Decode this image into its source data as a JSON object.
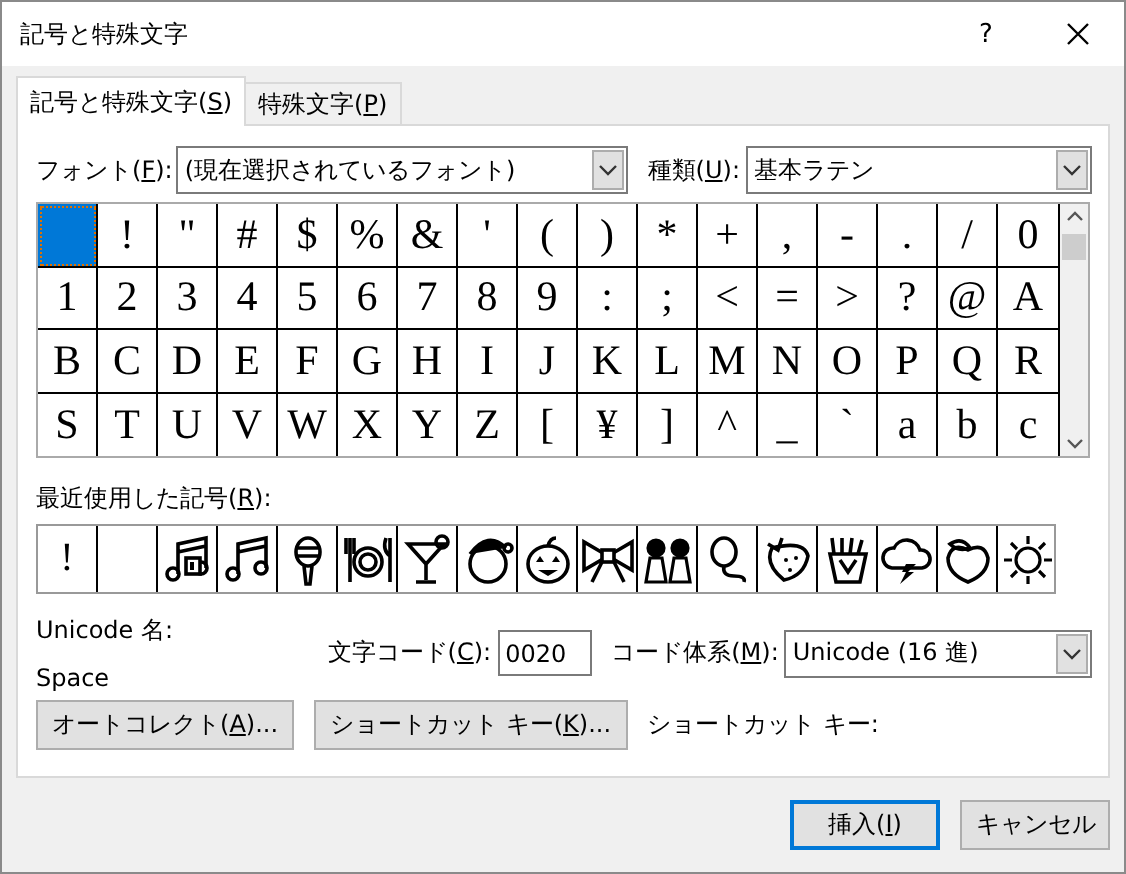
{
  "window": {
    "title": "記号と特殊文字",
    "help": "?"
  },
  "tabs": [
    {
      "before": "記号と特殊文字(",
      "key": "S",
      "after": ")",
      "selected": true
    },
    {
      "before": "特殊文字(",
      "key": "P",
      "after": ")",
      "selected": false
    }
  ],
  "font": {
    "label": {
      "before": "フォント(",
      "key": "F",
      "after": "):"
    },
    "value": "(現在選択されているフォント)"
  },
  "subset": {
    "label": {
      "before": "種類(",
      "key": "U",
      "after": "):"
    },
    "value": "基本ラテン"
  },
  "symbol_grid": [
    {
      "selected": true
    },
    {
      "char": "!",
      "selected": false
    },
    {
      "char": "\"",
      "selected": false
    },
    {
      "char": "#",
      "selected": false
    },
    {
      "char": "$",
      "selected": false
    },
    {
      "char": "%",
      "selected": false
    },
    {
      "char": "&",
      "selected": false
    },
    {
      "char": "'",
      "selected": false
    },
    {
      "char": "(",
      "selected": false
    },
    {
      "char": ")",
      "selected": false
    },
    {
      "char": "*",
      "selected": false
    },
    {
      "char": "+",
      "selected": false
    },
    {
      "char": ",",
      "selected": false
    },
    {
      "char": "-",
      "selected": false
    },
    {
      "char": ".",
      "selected": false
    },
    {
      "char": "/",
      "selected": false
    },
    {
      "char": "0",
      "selected": false
    },
    {
      "char": "1",
      "selected": false
    },
    {
      "char": "2",
      "selected": false
    },
    {
      "char": "3",
      "selected": false
    },
    {
      "char": "4",
      "selected": false
    },
    {
      "char": "5",
      "selected": false
    },
    {
      "char": "6",
      "selected": false
    },
    {
      "char": "7",
      "selected": false
    },
    {
      "char": "8",
      "selected": false
    },
    {
      "char": "9",
      "selected": false
    },
    {
      "char": ":",
      "selected": false
    },
    {
      "char": ";",
      "selected": false
    },
    {
      "char": "<",
      "selected": false
    },
    {
      "char": "=",
      "selected": false
    },
    {
      "char": ">",
      "selected": false
    },
    {
      "char": "?",
      "selected": false
    },
    {
      "char": "@",
      "selected": false
    },
    {
      "char": "A",
      "selected": false
    },
    {
      "char": "B",
      "selected": false
    },
    {
      "char": "C",
      "selected": false
    },
    {
      "char": "D",
      "selected": false
    },
    {
      "char": "E",
      "selected": false
    },
    {
      "char": "F",
      "selected": false
    },
    {
      "char": "G",
      "selected": false
    },
    {
      "char": "H",
      "selected": false
    },
    {
      "char": "I",
      "selected": false
    },
    {
      "char": "J",
      "selected": false
    },
    {
      "char": "K",
      "selected": false
    },
    {
      "char": "L",
      "selected": false
    },
    {
      "char": "M",
      "selected": false
    },
    {
      "char": "N",
      "selected": false
    },
    {
      "char": "O",
      "selected": false
    },
    {
      "char": "P",
      "selected": false
    },
    {
      "char": "Q",
      "selected": false
    },
    {
      "char": "R",
      "selected": false
    },
    {
      "char": "S",
      "selected": false
    },
    {
      "char": "T",
      "selected": false
    },
    {
      "char": "U",
      "selected": false
    },
    {
      "char": "V",
      "selected": false
    },
    {
      "char": "W",
      "selected": false
    },
    {
      "char": "X",
      "selected": false
    },
    {
      "char": "Y",
      "selected": false
    },
    {
      "char": "Z",
      "selected": false
    },
    {
      "char": "[",
      "selected": false
    },
    {
      "char": "¥",
      "selected": false
    },
    {
      "char": "]",
      "selected": false
    },
    {
      "char": "^",
      "selected": false
    },
    {
      "char": "_",
      "selected": false
    },
    {
      "char": "`",
      "selected": false
    },
    {
      "char": "a",
      "selected": false
    },
    {
      "char": "b",
      "selected": false
    },
    {
      "char": "c",
      "selected": false
    }
  ],
  "recent": {
    "label": {
      "before": "最近使用した記号(",
      "key": "R",
      "after": "):"
    },
    "items": [
      {
        "kind": "char",
        "char": "!"
      },
      {
        "kind": "blank"
      },
      {
        "kind": "notes"
      },
      {
        "kind": "note"
      },
      {
        "kind": "microphone"
      },
      {
        "kind": "plate"
      },
      {
        "kind": "cocktail"
      },
      {
        "kind": "hat-figure"
      },
      {
        "kind": "pumpkin"
      },
      {
        "kind": "bow"
      },
      {
        "kind": "dolls"
      },
      {
        "kind": "balloon"
      },
      {
        "kind": "strawberry"
      },
      {
        "kind": "fries"
      },
      {
        "kind": "storm"
      },
      {
        "kind": "peach"
      },
      {
        "kind": "sun"
      }
    ]
  },
  "unicode_name": {
    "label": "Unicode 名:",
    "value": "Space"
  },
  "char_code": {
    "label": {
      "before": "文字コード(",
      "key": "C",
      "after": "):"
    },
    "value": "0020"
  },
  "code_system": {
    "label": {
      "before": "コード体系(",
      "key": "M",
      "after": "):"
    },
    "value": "Unicode (16 進)"
  },
  "buttons": [
    {
      "before": "オートコレクト(",
      "key": "A",
      "after": ")..."
    },
    {
      "before": "ショートカット キー(",
      "key": "K",
      "after": ")..."
    }
  ],
  "shortcut_key_label": "ショートカット キー:",
  "footer_buttons": [
    {
      "before": "挿入(",
      "key": "I",
      "after": ")",
      "focused": true
    },
    {
      "before": "キャンセル",
      "focused": false
    }
  ]
}
